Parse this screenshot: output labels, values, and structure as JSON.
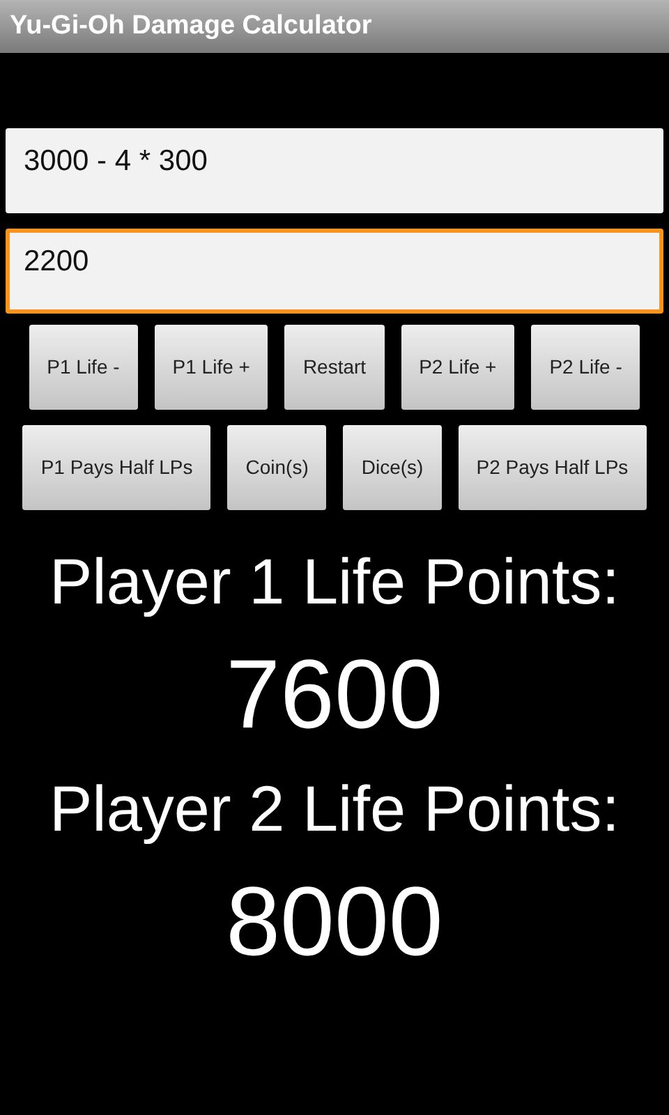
{
  "window": {
    "title": "Yu-Gi-Oh Damage Calculator"
  },
  "fields": [
    {
      "value": "3000 - 4 * 300",
      "focused": false
    },
    {
      "value": "2200",
      "focused": true
    }
  ],
  "button_rows": [
    [
      "P1 Life -",
      "P1 Life +",
      "Restart",
      "P2 Life +",
      "P2 Life -"
    ],
    [
      "P1 Pays Half LPs",
      "Coin(s)",
      "Dice(s)",
      "P2 Pays Half LPs"
    ]
  ],
  "players": [
    {
      "label": "Player 1 Life Points:",
      "points": "7600"
    },
    {
      "label": "Player 2 Life Points:",
      "points": "8000"
    }
  ]
}
